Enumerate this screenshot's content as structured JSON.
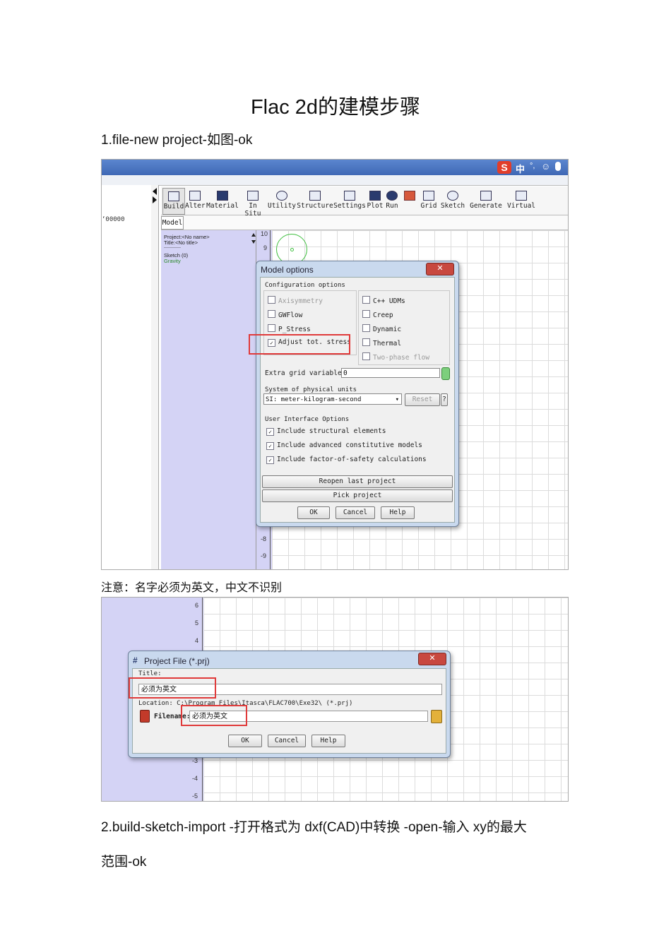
{
  "heading": "Flac 2d的建模步骤",
  "step1": "1.file-new project-如图-ok",
  "note": "注意：名字必须为英文，中文不识别",
  "step2_line1": "2.build-sketch-import -打开格式为  dxf(CAD)中转换 -open-输入 xy的最大",
  "step2_line2": "范围-ok",
  "shot1": {
    "taskbar_ime": [
      "中",
      "°,",
      "☺",
      "🎤"
    ],
    "coord_fragment": "‘00000",
    "toolbar": [
      "Build",
      "Alter",
      "Material",
      "In Situ",
      "Utility",
      "Structure",
      "Settings",
      "Plot",
      "Run",
      "Grid",
      "Sketch",
      "Generate",
      "Virtual"
    ],
    "model_tab": "Model",
    "tree": [
      "Project:<No name>",
      "Title:<No title>",
      "------------",
      "Sketch (0)",
      "Gravity"
    ],
    "y_ticks": [
      "10",
      "9",
      "-8",
      "-9"
    ],
    "dialog": {
      "title": "Model options",
      "close": "✕",
      "config_header": "Configuration options",
      "left_opts": [
        {
          "label": "Axisymmetry",
          "checked": false,
          "disabled": true
        },
        {
          "label": "GWFlow",
          "checked": false,
          "disabled": false
        },
        {
          "label": "P_Stress",
          "checked": false,
          "disabled": false
        },
        {
          "label": "Adjust tot. stress",
          "checked": true,
          "disabled": false
        }
      ],
      "right_opts": [
        {
          "label": "C++ UDMs",
          "checked": false,
          "disabled": false
        },
        {
          "label": "Creep",
          "checked": false,
          "disabled": false
        },
        {
          "label": "Dynamic",
          "checked": false,
          "disabled": false
        },
        {
          "label": "Thermal",
          "checked": false,
          "disabled": false
        },
        {
          "label": "Two-phase flow",
          "checked": false,
          "disabled": true
        }
      ],
      "extra_label": "Extra grid variables:",
      "extra_value": "0",
      "units_header": "System of physical units",
      "units_value": "SI: meter-kilogram-second",
      "reset": "Reset",
      "ui_header": "User Interface Options",
      "ui_opts": [
        {
          "label": "Include structural elements",
          "checked": true
        },
        {
          "label": "Include advanced constitutive models",
          "checked": true
        },
        {
          "label": "Include factor-of-safety calculations",
          "checked": true
        }
      ],
      "reopen": "Reopen last project",
      "pick": "Pick project",
      "ok": "OK",
      "cancel": "Cancel",
      "help": "Help"
    }
  },
  "shot2": {
    "y_ticks": [
      "6",
      "5",
      "4",
      "-3",
      "-4",
      "-5"
    ],
    "dialog": {
      "title": "Project File (*.prj)",
      "close": "✕",
      "title_label": "Title:",
      "title_value": "必须为英文",
      "location": "Location: C:\\Program Files\\Itasca\\FLAC700\\Exe32\\ (*.prj)",
      "filename_label": "Filename:",
      "filename_value": "必须为英文",
      "ok": "OK",
      "cancel": "Cancel",
      "help": "Help"
    }
  },
  "colors": {
    "accent_red": "#e03a3a",
    "panel_lavender": "#d4d3f5",
    "titlebar_blue": "#3f68b5"
  }
}
